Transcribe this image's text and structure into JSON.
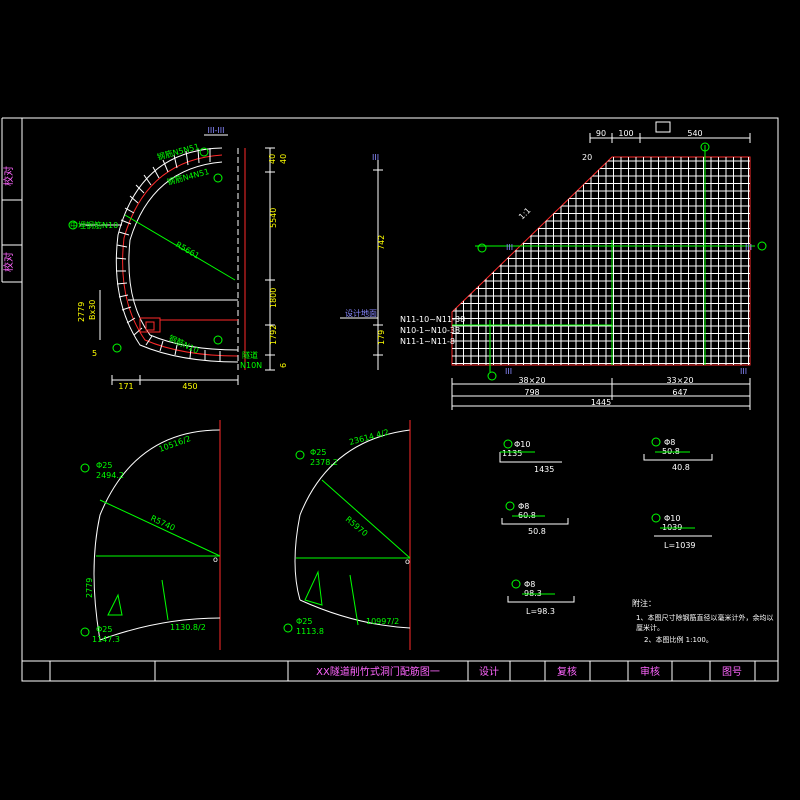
{
  "title_block": {
    "drawing_title": "XX隧道削竹式洞门配筋图一",
    "design": "设计",
    "review": "复核",
    "approve": "审核",
    "sheet_no": "图号"
  },
  "side_tabs": {
    "top": "校对",
    "bottom": "校对"
  },
  "section": {
    "label": "III-III",
    "dims": {
      "bottom_171": "171",
      "bottom_450": "450",
      "left_2779": "2779",
      "left_bx30": "Bx30",
      "top_40": "40",
      "top_5": "5",
      "r_5540": "5540",
      "r_1800": "1800",
      "r_1792": "1792",
      "r_40": "40",
      "r_6": "6",
      "radius": "R5661"
    },
    "notes": [
      "中埋钢筋N10",
      "钢筋N5N51",
      "钢筋N4N51",
      "钢筋N10",
      "隧道",
      "N10N"
    ]
  },
  "middle": {
    "top_label": "III",
    "label_742": "742",
    "label_179": "179",
    "ground_label": "设计地面"
  },
  "elevation": {
    "top_dims": [
      "90",
      "100",
      "540"
    ],
    "slope": "1:1",
    "left_labels": [
      "N11-10~N11-38",
      "N10-1~N10-38",
      "N11-1~N11-8"
    ],
    "bottom_dims_row1": [
      "38×20",
      "33×20"
    ],
    "bottom_dims_row2": [
      "798",
      "647"
    ],
    "bottom_total": "1445",
    "marks": [
      "III",
      "III",
      "III",
      "III"
    ]
  },
  "arc1": {
    "bar": "Φ25",
    "len": "2494.2",
    "r": "R5740",
    "arc_len": "10516/2",
    "side": "2779",
    "tip": "Φ25",
    "tip_len": "1147.3",
    "mark1": "⑤",
    "mark2": "⑤",
    "seg": "8",
    "seg2": "1130.8/2"
  },
  "arc2": {
    "bar": "Φ25",
    "len": "2378.2",
    "r": "R5970",
    "arc_len": "23614.4/2",
    "tip": "Φ25",
    "tip_len": "1113.8",
    "seg2": "10997/2"
  },
  "bars": [
    {
      "mark": "⑥",
      "dia": "Φ10",
      "len1": "1135",
      "len2": "1435"
    },
    {
      "mark": "⑦",
      "dia": "Φ8",
      "len1": "50.8",
      "len2": "40.8"
    },
    {
      "mark": "⑧",
      "dia": "Φ8",
      "len1": "60.8",
      "len2": "50.8"
    },
    {
      "mark": "⑨",
      "dia": "Φ10",
      "len1": "1039",
      "len2": "L=1039"
    },
    {
      "mark": "⑩",
      "dia": "Φ8",
      "len1": "98.3",
      "len2": "L=98.3"
    }
  ],
  "notes": {
    "heading": "附注：",
    "line1": "1、本图尺寸除钢筋直径以毫米计外，余均以",
    "line1b": "厘米计。",
    "line2": "2、本图比例 1:100。"
  }
}
